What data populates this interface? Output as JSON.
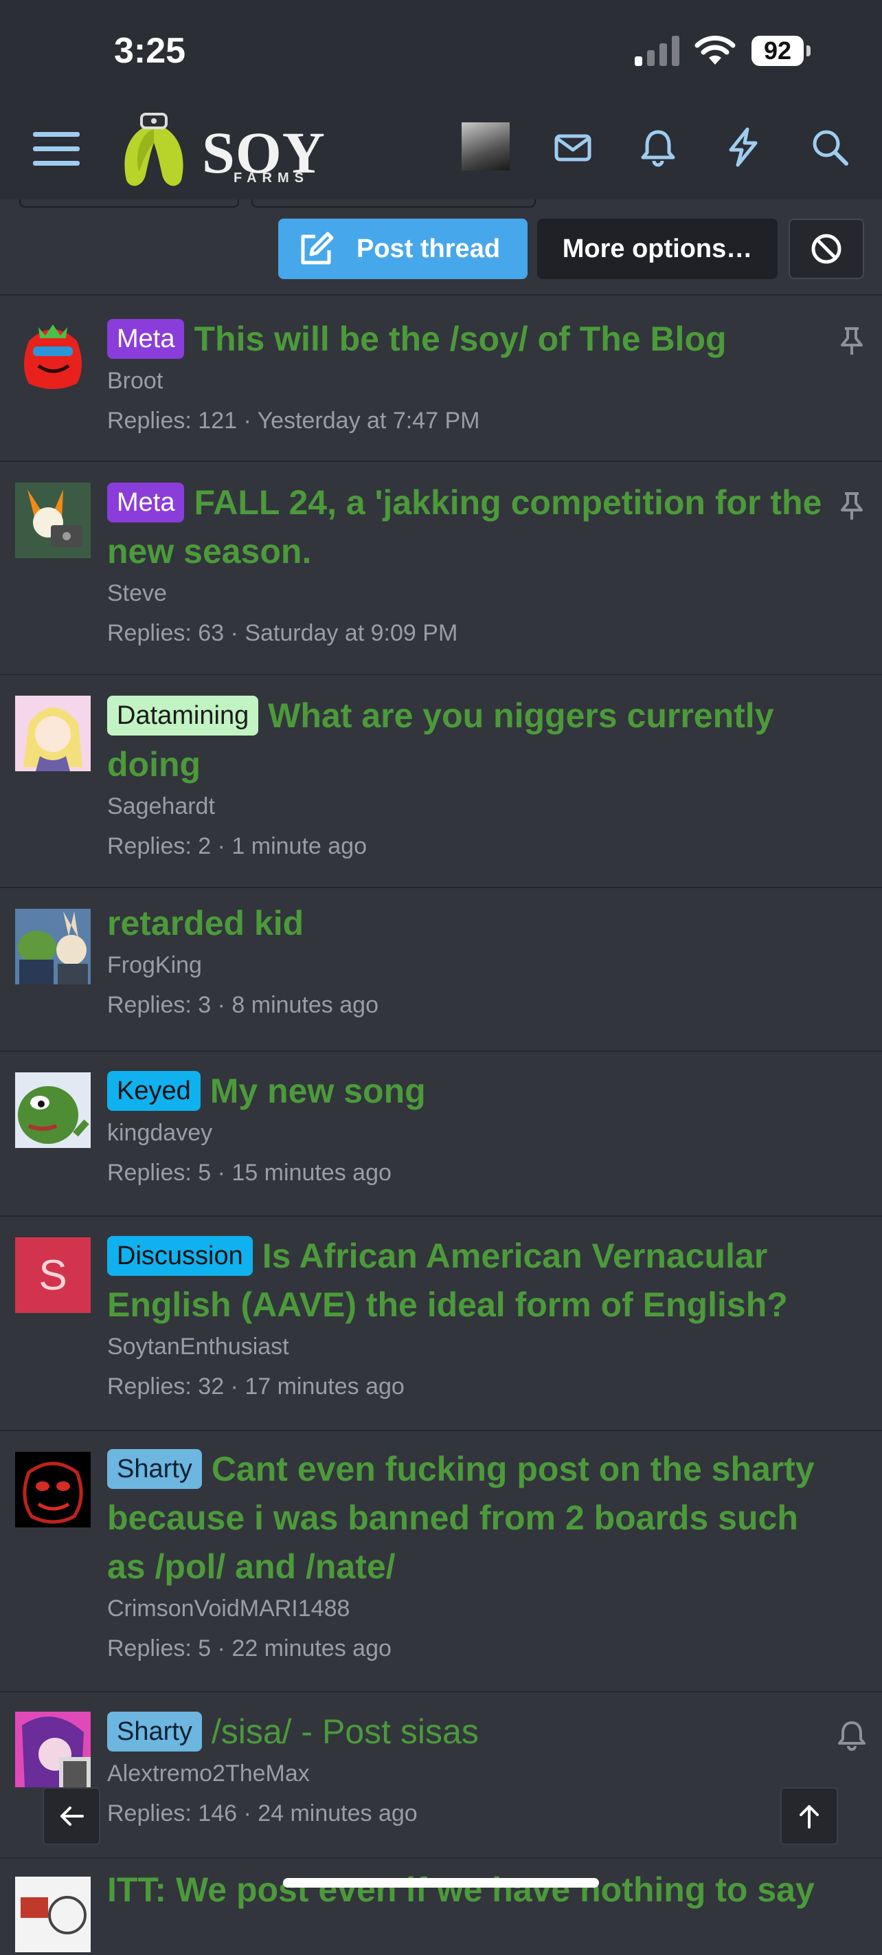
{
  "status_bar": {
    "time": "3:25",
    "battery": "92"
  },
  "header": {
    "logo_word": "SOY",
    "logo_sub": "FARMS"
  },
  "toolbar": {
    "post_thread": "Post thread",
    "more_options": "More options…"
  },
  "colors": {
    "title_green": "#4c9a3a",
    "accent_blue": "#47a7eb",
    "bg": "#32353c"
  },
  "threads": [
    {
      "prefix": "Meta",
      "title": "This will be the /soy/ of The Blog",
      "author": "Broot",
      "replies": "Replies: 121 · Yesterday at 7:47 PM",
      "pinned": true,
      "avatar_icon": "red-frog-avatar-icon"
    },
    {
      "prefix": "Meta",
      "title": "FALL 24, a 'jakking competition for the new season.",
      "author": "Steve",
      "replies": "Replies: 63 · Saturday at 9:09 PM",
      "pinned": true,
      "avatar_icon": "cartoon-avatar-icon"
    },
    {
      "prefix": "Datamining",
      "title": "What are you niggers currently doing",
      "author": "Sagehardt",
      "replies": "Replies: 2 · 1 minute ago",
      "avatar_icon": "anime-girl-avatar-icon"
    },
    {
      "prefix": "",
      "title": "retarded kid",
      "author": "FrogKing",
      "replies": "Replies: 3 · 8 minutes ago",
      "avatar_icon": "frog-rabbit-avatar-icon"
    },
    {
      "prefix": "Keyed",
      "title": "My new song",
      "author": "kingdavey",
      "replies": "Replies: 5 · 15 minutes ago",
      "avatar_icon": "pepe-avatar-icon"
    },
    {
      "prefix": "Discussion",
      "title": "Is African American Vernacular English (AAVE) the ideal form of English?",
      "author": "SoytanEnthusiast",
      "replies": "Replies: 32 · 17 minutes ago",
      "avatar_letter": "S"
    },
    {
      "prefix": "Sharty",
      "title": "Cant even fucking post on the sharty because i was banned from 2 boards such as /pol/ and /nate/",
      "author": "CrimsonVoidMARI1488",
      "replies": "Replies: 5 · 22 minutes ago",
      "avatar_icon": "dark-red-avatar-icon"
    },
    {
      "prefix": "Sharty",
      "title": "/sisa/ - Post sisas",
      "author": "Alextremo2TheMax",
      "replies": "Replies: 146 · 24 minutes ago",
      "watched": true,
      "avatar_icon": "anime-purple-avatar-icon"
    },
    {
      "prefix": "",
      "title": "ITT: We post even if we have nothing to say",
      "author": "",
      "replies": "",
      "avatar_icon": "comic-avatar-icon"
    }
  ]
}
